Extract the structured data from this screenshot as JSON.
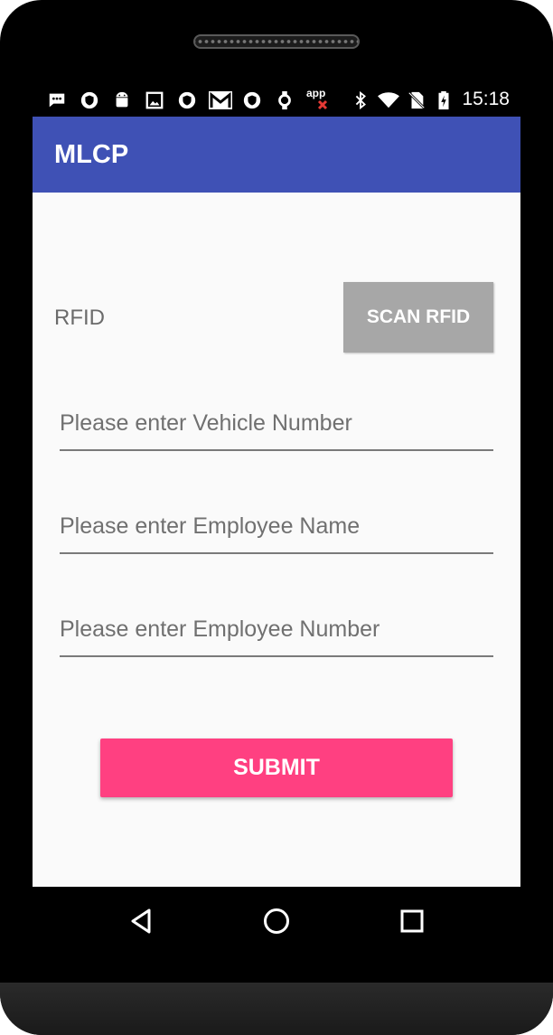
{
  "status_bar": {
    "time": "15:18",
    "icons": [
      "message-icon",
      "shield-icon",
      "android-icon",
      "image-icon",
      "shield-icon",
      "gmail-icon",
      "shield-icon",
      "watch-icon",
      "appmaker-icon",
      "bluetooth-icon",
      "wifi-icon",
      "no-sim-icon",
      "battery-icon"
    ],
    "app_icon_text": "app"
  },
  "app_bar": {
    "title": "MLCP",
    "color": "#3f51b5"
  },
  "form": {
    "rfid_label": "RFID",
    "scan_button": "SCAN RFID",
    "vehicle_placeholder": "Please enter Vehicle Number",
    "employee_name_placeholder": "Please enter Employee Name",
    "employee_number_placeholder": "Please enter Employee Number",
    "submit_button": "SUBMIT",
    "submit_color": "#ff4081"
  },
  "nav_bar": {
    "icons": [
      "back-icon",
      "home-icon",
      "recents-icon"
    ]
  }
}
